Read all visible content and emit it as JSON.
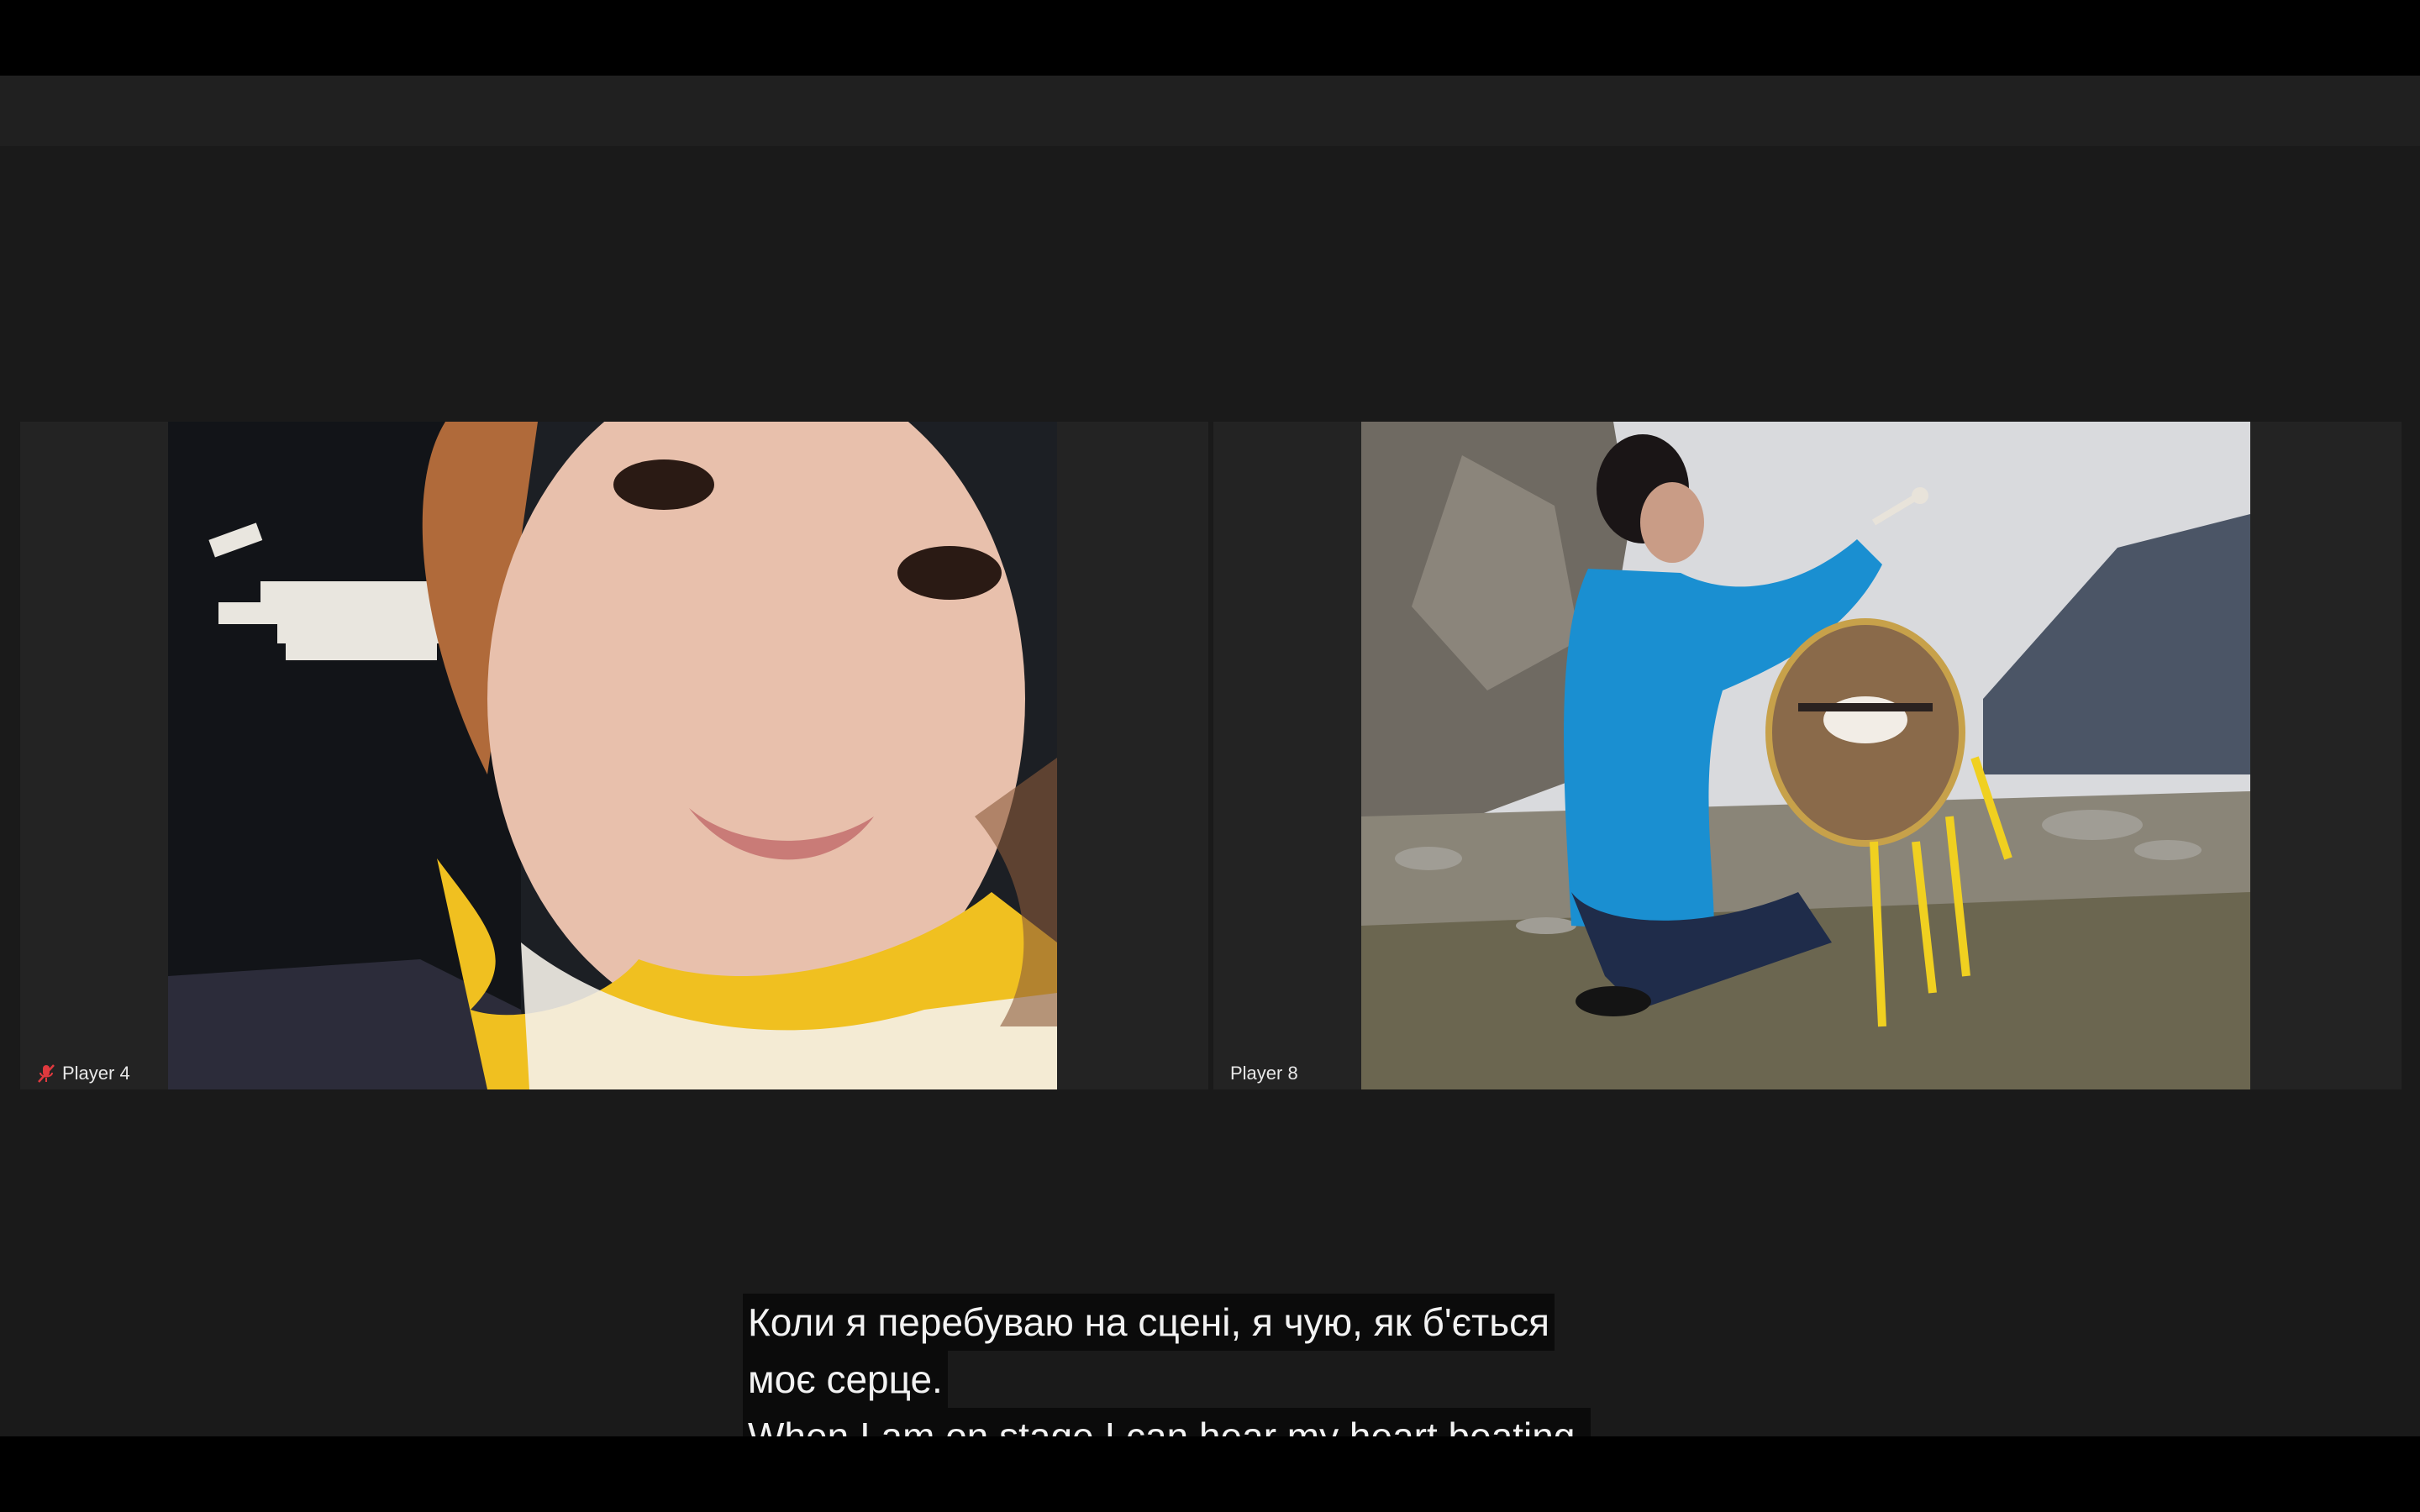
{
  "participants": [
    {
      "name": "Player 4",
      "muted": true,
      "video": "woman-closeup-yellow-ribbons"
    },
    {
      "name": "Player 8",
      "muted": false,
      "video": "woman-playing-frame-drum-outdoors"
    }
  ],
  "captions": {
    "line1": "Коли я перебуваю на сцені, я чую, як б'ється",
    "line2": "моє серце.",
    "line3": "When I am on stage I can hear my heart beating."
  },
  "colors": {
    "background": "#1a1a1a",
    "tile": "#232323",
    "mute_red": "#e0393e",
    "caption_bg": "#0b0b0b"
  }
}
